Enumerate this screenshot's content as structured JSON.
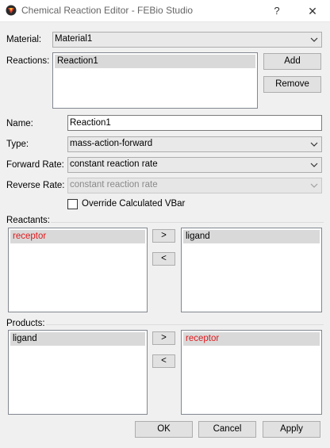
{
  "window": {
    "title": "Chemical Reaction Editor - FEBio Studio",
    "help_glyph": "?",
    "close_glyph": "✕"
  },
  "material": {
    "label": "Material:",
    "value": "Material1"
  },
  "reactions": {
    "label": "Reactions:",
    "items": [
      "Reaction1"
    ],
    "add_label": "Add",
    "remove_label": "Remove"
  },
  "name": {
    "label": "Name:",
    "value": "Reaction1"
  },
  "type": {
    "label": "Type:",
    "value": "mass-action-forward"
  },
  "forward_rate": {
    "label": "Forward Rate:",
    "value": "constant reaction rate"
  },
  "reverse_rate": {
    "label": "Reverse Rate:",
    "value": "constant reaction rate",
    "disabled": true
  },
  "override_vbar": {
    "label": "Override Calculated VBar",
    "checked": false
  },
  "reactants": {
    "label": "Reactants:",
    "left_items": [
      "receptor"
    ],
    "right_items": [
      "ligand"
    ],
    "move_right_label": ">",
    "move_left_label": "<"
  },
  "products": {
    "label": "Products:",
    "left_items": [
      "ligand"
    ],
    "right_items": [
      "receptor"
    ],
    "move_right_label": ">",
    "move_left_label": "<"
  },
  "footer": {
    "ok_label": "OK",
    "cancel_label": "Cancel",
    "apply_label": "Apply"
  },
  "colors": {
    "highlight_text": "#e0181c",
    "selection_bg": "#d9d9d9",
    "window_bg": "#f0f0f0"
  }
}
